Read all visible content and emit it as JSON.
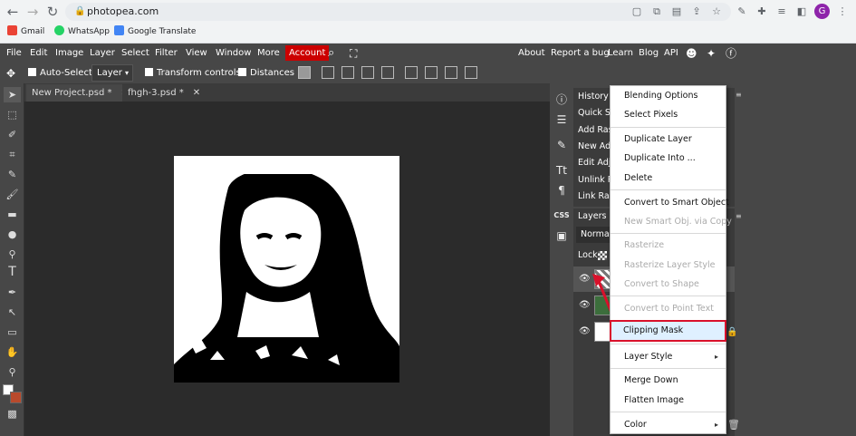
{
  "browser": {
    "url": "photopea.com",
    "avatar_letter": "G",
    "bookmarks": [
      "Gmail",
      "WhatsApp",
      "Google Translate"
    ]
  },
  "menubar": {
    "items": [
      "File",
      "Edit",
      "Image",
      "Layer",
      "Select",
      "Filter",
      "View",
      "Window",
      "More"
    ],
    "account": "Account",
    "right_links": [
      "About",
      "Report a bug",
      "Learn",
      "Blog",
      "API"
    ]
  },
  "options": {
    "auto_select": "Auto-Select",
    "layer_select": "Layer",
    "transform_controls": "Transform controls",
    "distances": "Distances"
  },
  "tabs": [
    {
      "label": "New Project.psd *"
    },
    {
      "label": "fhgh-3.psd *"
    }
  ],
  "history_panel": {
    "title": "History",
    "items": [
      "Quick Se",
      "Add Rast",
      "New Adj",
      "Edit Adju",
      "Unlink R",
      "Link Rast"
    ]
  },
  "layers_panel": {
    "title": "Layers",
    "blend": "Normal",
    "lock": "Lock:"
  },
  "side_icons": {
    "css": "CSS"
  },
  "context_menu": {
    "items": [
      {
        "label": "Blending Options",
        "disabled": false
      },
      {
        "label": "Select Pixels",
        "disabled": false
      },
      {
        "label": "Duplicate Layer",
        "disabled": false
      },
      {
        "label": "Duplicate Into ...",
        "disabled": false
      },
      {
        "label": "Delete",
        "disabled": false
      },
      {
        "label": "Convert to Smart Object",
        "disabled": false
      },
      {
        "label": "New Smart Obj. via Copy",
        "disabled": true
      },
      {
        "label": "Rasterize",
        "disabled": true
      },
      {
        "label": "Rasterize Layer Style",
        "disabled": true
      },
      {
        "label": "Convert to Shape",
        "disabled": true
      },
      {
        "label": "Convert to Point Text",
        "disabled": true
      },
      {
        "label": "Clipping Mask",
        "disabled": false,
        "highlighted": true
      },
      {
        "label": "Layer Style",
        "disabled": false,
        "submenu": true
      },
      {
        "label": "Merge Down",
        "disabled": false
      },
      {
        "label": "Flatten Image",
        "disabled": false
      },
      {
        "label": "Color",
        "disabled": false,
        "submenu": true
      }
    ]
  },
  "colors": {
    "accent_red": "#d9112b",
    "account_bg": "#cc0000",
    "foreground": "#ffffff",
    "background_swatch": "#b94a2c"
  }
}
